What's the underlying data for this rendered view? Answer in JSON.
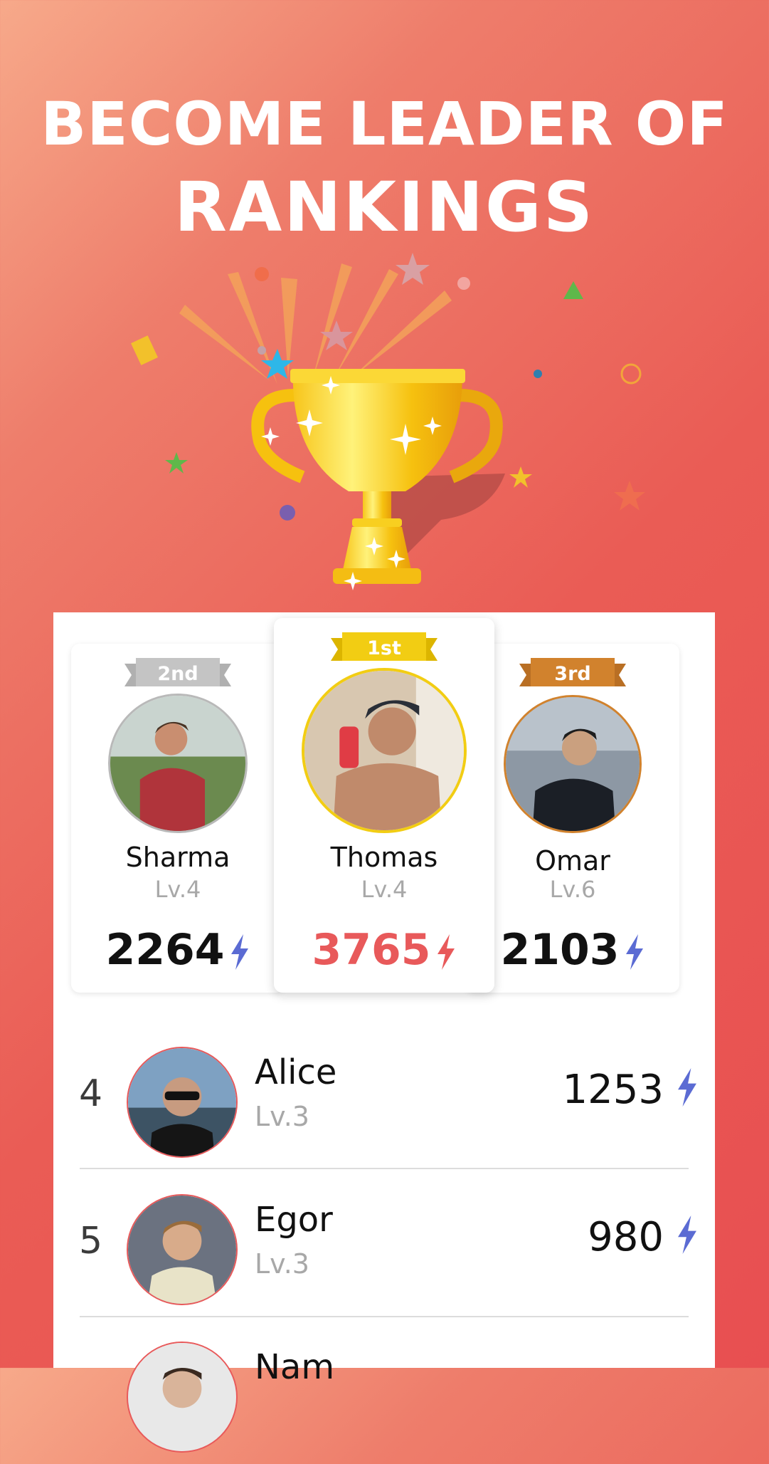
{
  "hero": {
    "title_line1": "BECOME LEADER OF",
    "title_line2": "RANKINGS"
  },
  "colors": {
    "accent_red": "#e8595a",
    "gold": "#f2cd13",
    "silver": "#c4c4c4",
    "bronze": "#d1822d",
    "bolt_blue": "#5b6bd3",
    "bolt_red": "#e8595a"
  },
  "podium": {
    "first": {
      "badge": "1st",
      "name": "Thomas",
      "level": "Lv.4",
      "score": "3765"
    },
    "second": {
      "badge": "2nd",
      "name": "Sharma",
      "level": "Lv.4",
      "score": "2264"
    },
    "third": {
      "badge": "3rd",
      "name": "Omar",
      "level": "Lv.6",
      "score": "2103"
    }
  },
  "rankings": [
    {
      "rank": "4",
      "name": "Alice",
      "level": "Lv.3",
      "score": "1253"
    },
    {
      "rank": "5",
      "name": "Egor",
      "level": "Lv.3",
      "score": "980"
    },
    {
      "rank": "",
      "name": "Nam",
      "level": "",
      "score": ""
    }
  ],
  "icons": {
    "trophy": "trophy-illustration",
    "score": "lightning-bolt-icon"
  }
}
